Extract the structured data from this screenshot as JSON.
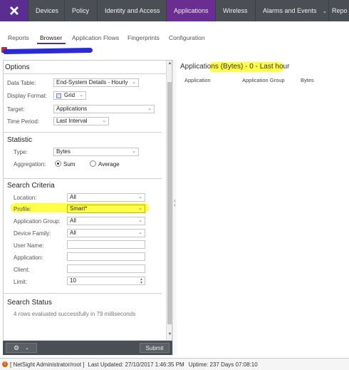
{
  "nav": {
    "tabs": [
      {
        "label": "Devices"
      },
      {
        "label": "Policy"
      },
      {
        "label": "Identity and Access"
      },
      {
        "label": "Applications"
      },
      {
        "label": "Wireless"
      },
      {
        "label": "Alarms and Events"
      },
      {
        "label": "Repo"
      }
    ]
  },
  "subtabs": [
    "Reports",
    "Browser",
    "Application Flows",
    "Fingerprints",
    "Configuration"
  ],
  "options": {
    "title": "Options",
    "data_table_label": "Data Table:",
    "data_table_value": "End-System Details - Hourly",
    "display_format_label": "Display Format:",
    "display_format_value": "Grid",
    "target_label": "Target:",
    "target_value": "Applications",
    "time_period_label": "Time Period:",
    "time_period_value": "Last Interval"
  },
  "statistic": {
    "title": "Statistic",
    "type_label": "Type:",
    "type_value": "Bytes",
    "aggregation_label": "Aggregation:",
    "agg_sum": "Sum",
    "agg_average": "Average"
  },
  "search": {
    "title": "Search Criteria",
    "location_label": "Location:",
    "location_value": "All",
    "profile_label": "Profile:",
    "profile_value": "Smart*",
    "app_group_label": "Application Group:",
    "app_group_value": "All",
    "device_family_label": "Device Family:",
    "device_family_value": "All",
    "user_name_label": "User Name:",
    "application_label": "Application:",
    "client_label": "Client:",
    "limit_label": "Limit:",
    "limit_value": "10"
  },
  "status": {
    "title": "Search Status",
    "message": "4 rows evaluated successfully in 79 milliseconds"
  },
  "bottom": {
    "submit_label": "Submit"
  },
  "results": {
    "title": "Applications (Bytes) - 0 - Last hour",
    "columns": [
      "Application",
      "Application Group",
      "Bytes"
    ]
  },
  "statusbar": {
    "user": "[ NetSight Administrator/root ]",
    "last_updated": "Last Updated: 27/10/2017 1:46:35 PM",
    "uptime": "Uptime: 237 Days 07:08:10"
  },
  "colors": {
    "nav_bg": "#4a4f55",
    "accent": "#5c2d91",
    "highlight": "#ffff33"
  }
}
